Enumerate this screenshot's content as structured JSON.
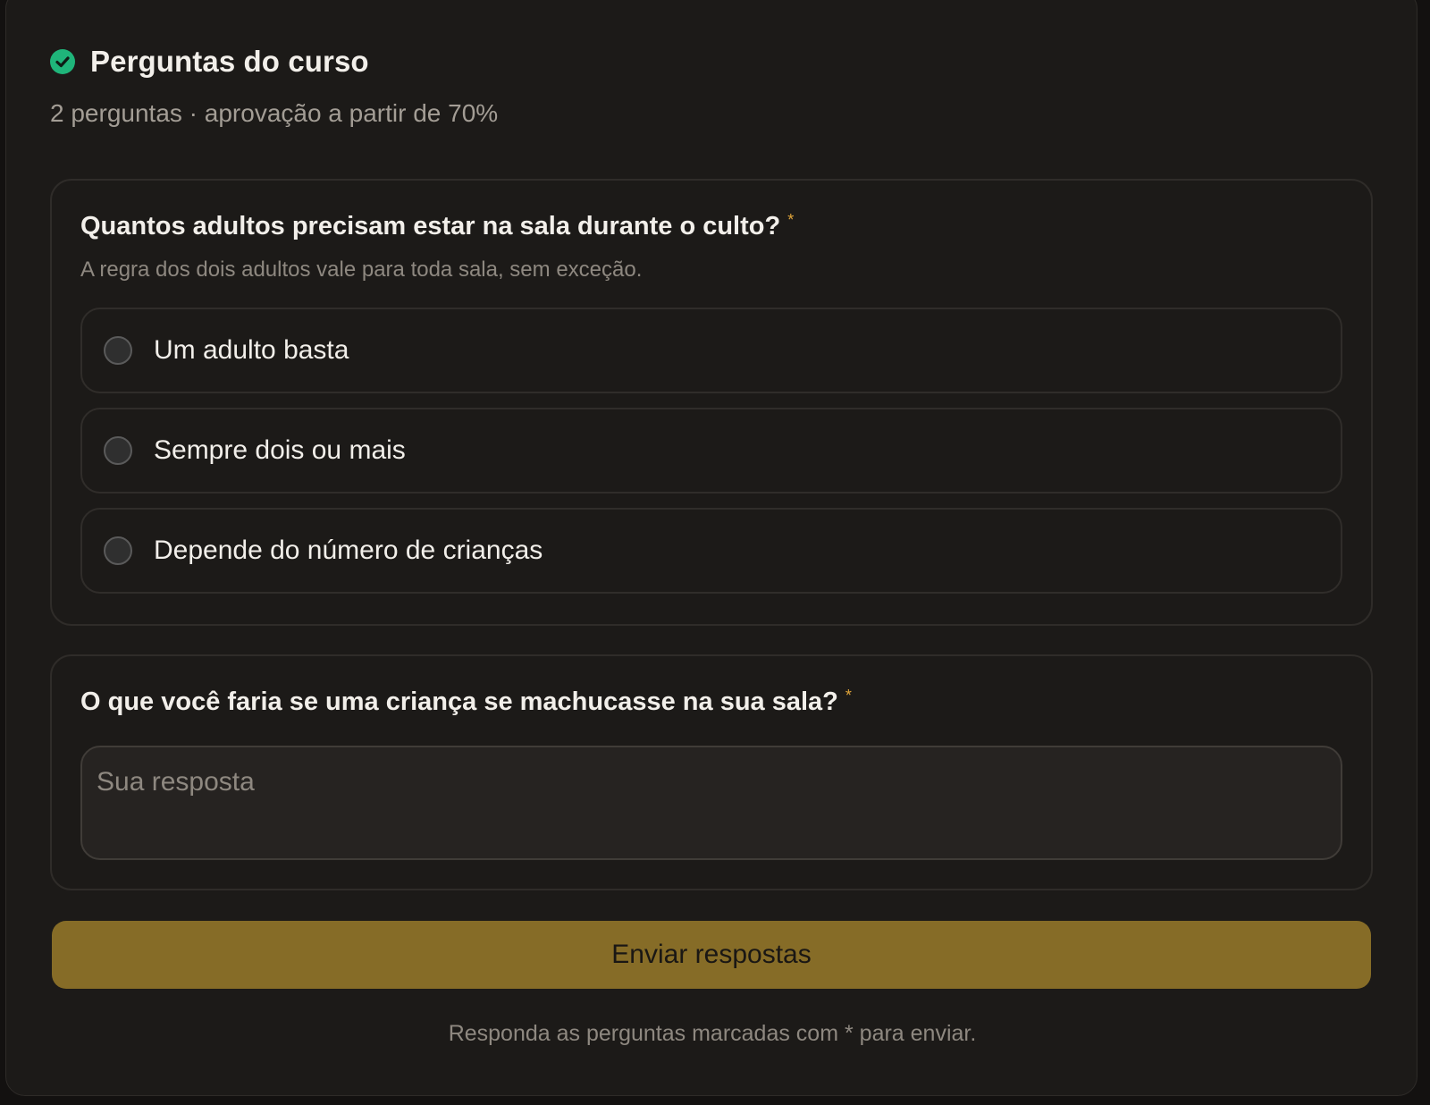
{
  "header": {
    "title": "Perguntas do curso",
    "subtitle": "2 perguntas · aprovação a partir de 70%",
    "status_icon": "check-circle-icon"
  },
  "questions": [
    {
      "title": "Quantos adultos precisam estar na sala durante o culto?",
      "required_mark": "*",
      "hint": "A regra dos dois adultos vale para toda sala, sem exceção.",
      "options": [
        {
          "label": "Um adulto basta",
          "selected": false
        },
        {
          "label": "Sempre dois ou mais",
          "selected": false
        },
        {
          "label": "Depende do número de crianças",
          "selected": false
        }
      ]
    },
    {
      "title": "O que você faria se uma criança se machucasse na sua sala?",
      "required_mark": "*",
      "answer_value": "",
      "answer_placeholder": "Sua resposta"
    }
  ],
  "submit_label": "Enviar respostas",
  "footnote": "Responda as perguntas marcadas com * para enviar.",
  "colors": {
    "accent": "#866c27",
    "success": "#1fb57a",
    "required": "#e0a53a",
    "background": "#1c1a18"
  }
}
